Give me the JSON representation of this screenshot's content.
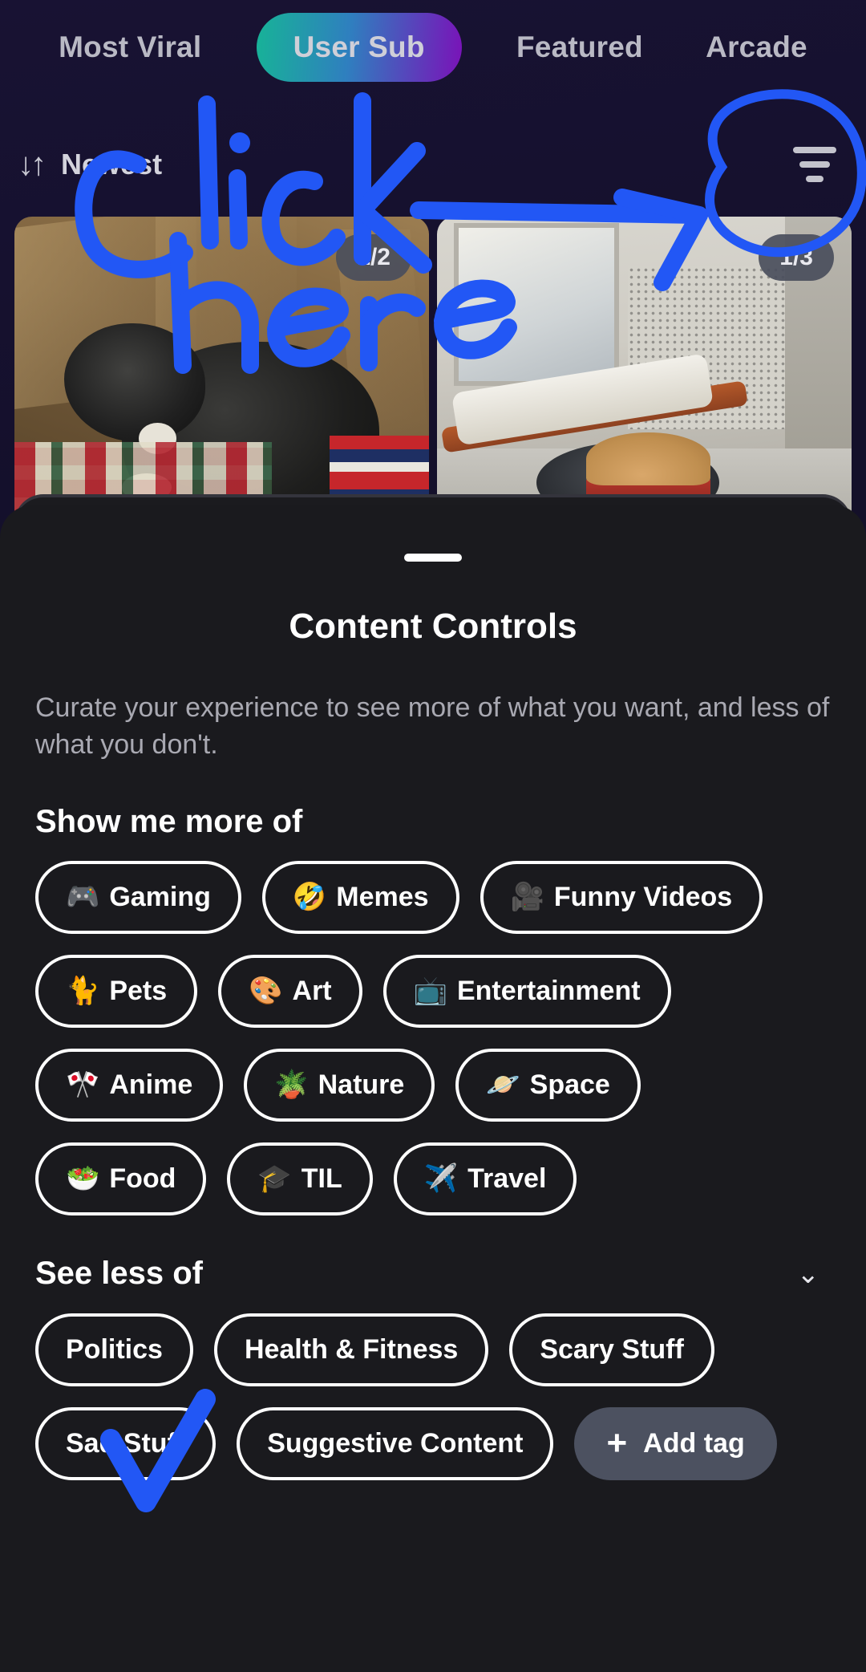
{
  "tabs": [
    {
      "label": "Most Viral",
      "active": false
    },
    {
      "label": "User Sub",
      "active": true
    },
    {
      "label": "Featured",
      "active": false
    },
    {
      "label": "Arcade",
      "active": false
    }
  ],
  "sort": {
    "icon": "sort-arrows-icon",
    "label": "Newest"
  },
  "filter": {
    "icon": "filter-lines-icon"
  },
  "gallery": [
    {
      "name": "cat-post-thumbnail",
      "badge": "1/2"
    },
    {
      "name": "kitchen-burger-post-thumbnail",
      "badge": "1/3"
    }
  ],
  "sheet": {
    "title": "Content Controls",
    "description": "Curate your experience to see more of what you want, and less of what you don't."
  },
  "show_more": {
    "title": "Show me more of",
    "chips": [
      {
        "emoji": "🎮",
        "label": "Gaming"
      },
      {
        "emoji": "🤣",
        "label": "Memes"
      },
      {
        "emoji": "🎥",
        "label": "Funny Videos"
      },
      {
        "emoji": "🐈",
        "label": "Pets"
      },
      {
        "emoji": "🎨",
        "label": "Art"
      },
      {
        "emoji": "📺",
        "label": "Entertainment"
      },
      {
        "emoji": "🎌",
        "label": "Anime"
      },
      {
        "emoji": "🪴",
        "label": "Nature"
      },
      {
        "emoji": "🪐",
        "label": "Space"
      },
      {
        "emoji": "🥗",
        "label": "Food"
      },
      {
        "emoji": "🎓",
        "label": "TIL"
      },
      {
        "emoji": "✈️",
        "label": "Travel"
      }
    ]
  },
  "see_less": {
    "title": "See less of",
    "collapse_icon": "chevron-down-icon",
    "chips": [
      {
        "label": "Politics"
      },
      {
        "label": "Health & Fitness"
      },
      {
        "label": "Scary Stuff"
      },
      {
        "label": "Sad Stuff"
      },
      {
        "label": "Suggestive Content"
      }
    ],
    "add_tag": {
      "label": "Add tag",
      "icon": "plus-icon"
    }
  },
  "annotations": {
    "click_here_text": "Click here",
    "ink_color": "#2257f5"
  }
}
